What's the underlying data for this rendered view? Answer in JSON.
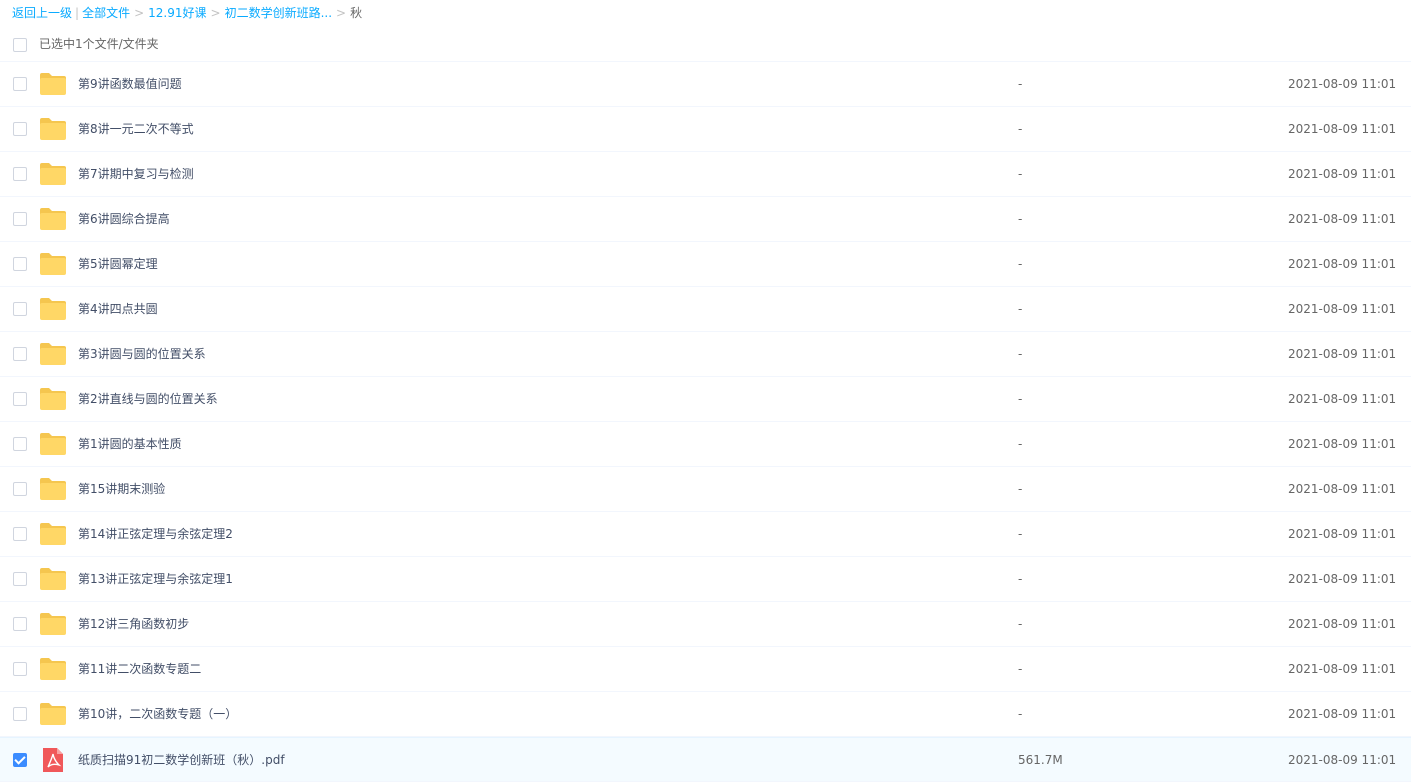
{
  "breadcrumb": {
    "back": "返回上一级",
    "pipe": "|",
    "sep": ">",
    "all_files": "全部文件",
    "level1": "12.91好课",
    "level2": "初二数学创新班路...",
    "current": "秋"
  },
  "selection": {
    "summary": "已选中1个文件/文件夹"
  },
  "files": [
    {
      "name": "第9讲函数最值问题",
      "size": "-",
      "date": "2021-08-09 11:01",
      "type": "folder",
      "checked": false
    },
    {
      "name": "第8讲一元二次不等式",
      "size": "-",
      "date": "2021-08-09 11:01",
      "type": "folder",
      "checked": false
    },
    {
      "name": "第7讲期中复习与检测",
      "size": "-",
      "date": "2021-08-09 11:01",
      "type": "folder",
      "checked": false
    },
    {
      "name": "第6讲圆综合提高",
      "size": "-",
      "date": "2021-08-09 11:01",
      "type": "folder",
      "checked": false
    },
    {
      "name": "第5讲圆幂定理",
      "size": "-",
      "date": "2021-08-09 11:01",
      "type": "folder",
      "checked": false
    },
    {
      "name": "第4讲四点共圆",
      "size": "-",
      "date": "2021-08-09 11:01",
      "type": "folder",
      "checked": false
    },
    {
      "name": "第3讲圆与圆的位置关系",
      "size": "-",
      "date": "2021-08-09 11:01",
      "type": "folder",
      "checked": false
    },
    {
      "name": "第2讲直线与圆的位置关系",
      "size": "-",
      "date": "2021-08-09 11:01",
      "type": "folder",
      "checked": false
    },
    {
      "name": "第1讲圆的基本性质",
      "size": "-",
      "date": "2021-08-09 11:01",
      "type": "folder",
      "checked": false
    },
    {
      "name": "第15讲期末测验",
      "size": "-",
      "date": "2021-08-09 11:01",
      "type": "folder",
      "checked": false
    },
    {
      "name": "第14讲正弦定理与余弦定理2",
      "size": "-",
      "date": "2021-08-09 11:01",
      "type": "folder",
      "checked": false
    },
    {
      "name": "第13讲正弦定理与余弦定理1",
      "size": "-",
      "date": "2021-08-09 11:01",
      "type": "folder",
      "checked": false
    },
    {
      "name": "第12讲三角函数初步",
      "size": "-",
      "date": "2021-08-09 11:01",
      "type": "folder",
      "checked": false
    },
    {
      "name": "第11讲二次函数专题二",
      "size": "-",
      "date": "2021-08-09 11:01",
      "type": "folder",
      "checked": false
    },
    {
      "name": "第10讲，二次函数专题（一）",
      "size": "-",
      "date": "2021-08-09 11:01",
      "type": "folder",
      "checked": false
    },
    {
      "name": "纸质扫描91初二数学创新班（秋）.pdf",
      "size": "561.7M",
      "date": "2021-08-09 11:01",
      "type": "pdf",
      "checked": true
    }
  ],
  "colors": {
    "link": "#09aaff",
    "folder": "#ffd766",
    "folder_tab": "#f5c64f",
    "pdf": "#f0585a",
    "check": "#3b8cff"
  }
}
